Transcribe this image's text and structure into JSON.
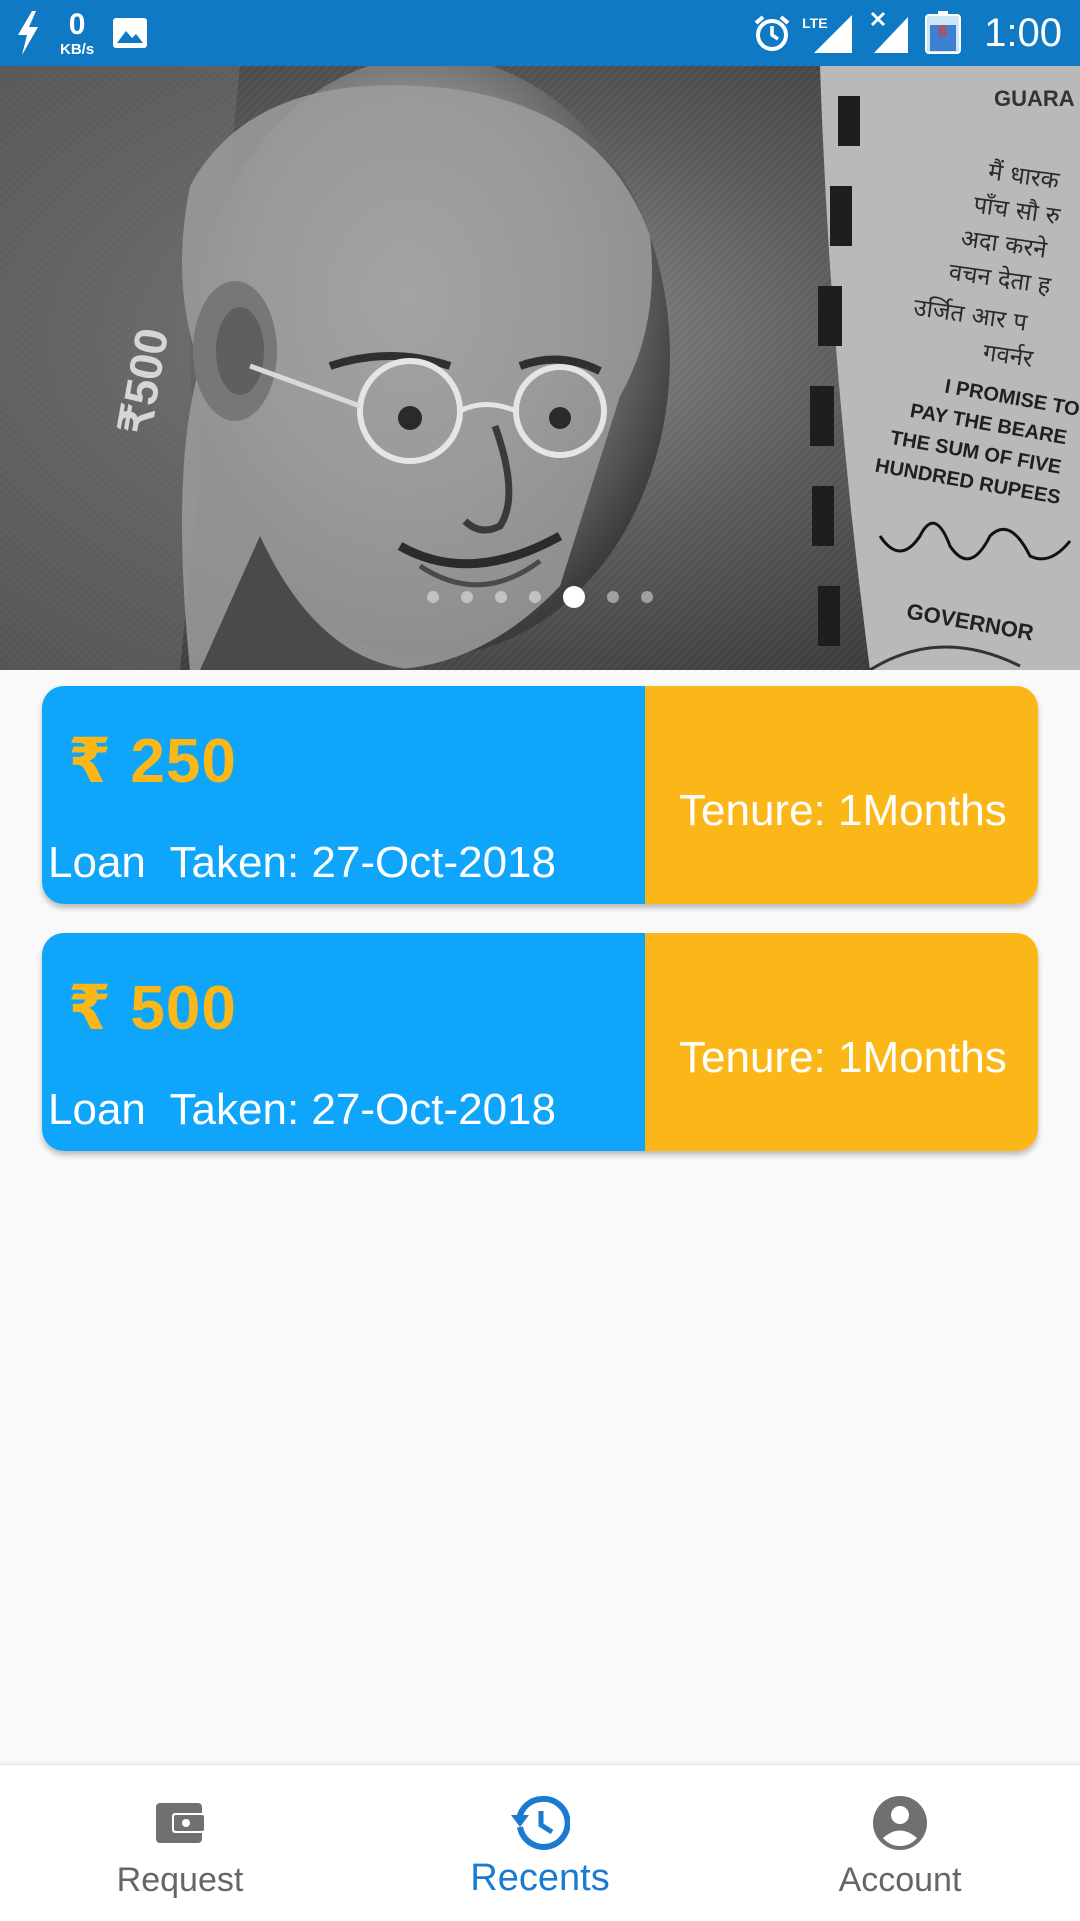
{
  "status_bar": {
    "speed_value": "0",
    "speed_unit": "KB/s",
    "network": "LTE",
    "battery_level": "6",
    "time": "1:00"
  },
  "banner": {
    "denomination": "₹500",
    "note_text_hindi": [
      "मैं धारक",
      "पाँच सौ रु",
      "अदा करने",
      "वचन देता ह",
      "उर्जित आर प",
      "गवर्नर"
    ],
    "note_text_english": [
      "I PROMISE TO",
      "PAY THE BEARE",
      "THE SUM OF FIVE",
      "HUNDRED RUPEES"
    ],
    "guarantee_text": "GUARA",
    "governor_label": "GOVERNOR",
    "carousel_count": 7,
    "carousel_active_index": 4
  },
  "loans": [
    {
      "amount": "₹ 250",
      "taken_label": "Loan  Taken: 27-Oct-2018",
      "tenure_label": "Tenure: 1Months"
    },
    {
      "amount": "₹ 500",
      "taken_label": "Loan  Taken: 27-Oct-2018",
      "tenure_label": "Tenure: 1Months"
    }
  ],
  "bottom_nav": {
    "items": [
      {
        "label": "Request",
        "icon": "wallet-icon",
        "active": false
      },
      {
        "label": "Recents",
        "icon": "history-icon",
        "active": true
      },
      {
        "label": "Account",
        "icon": "account-circle-icon",
        "active": false
      }
    ],
    "active_color": "#1a7bd0",
    "inactive_color": "#666666"
  },
  "colors": {
    "status_bar": "#0f79c4",
    "card_blue": "#0ea5fb",
    "card_yellow": "#fbb718"
  }
}
